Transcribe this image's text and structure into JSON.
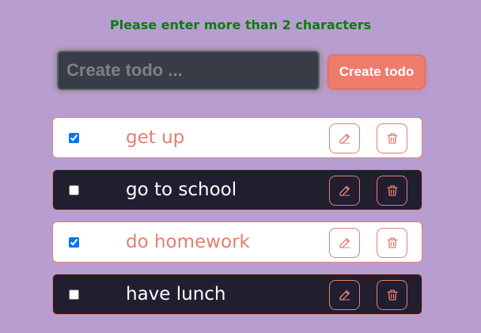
{
  "validation_message": "Please enter more than 2 characters",
  "create": {
    "placeholder": "Create todo ...",
    "value": "",
    "button_label": "Create todo"
  },
  "todos": [
    {
      "label": "get up",
      "completed": true
    },
    {
      "label": "go to school",
      "completed": false
    },
    {
      "label": "do homework",
      "completed": true
    },
    {
      "label": "have lunch",
      "completed": false
    }
  ],
  "colors": {
    "background": "#b89ed0",
    "accent": "#ee7b6c",
    "validation": "#0b7d0b",
    "dark_row": "#211e30",
    "light_row": "#ffffff"
  },
  "icons": {
    "edit": "pencil-icon",
    "delete": "trash-icon"
  }
}
